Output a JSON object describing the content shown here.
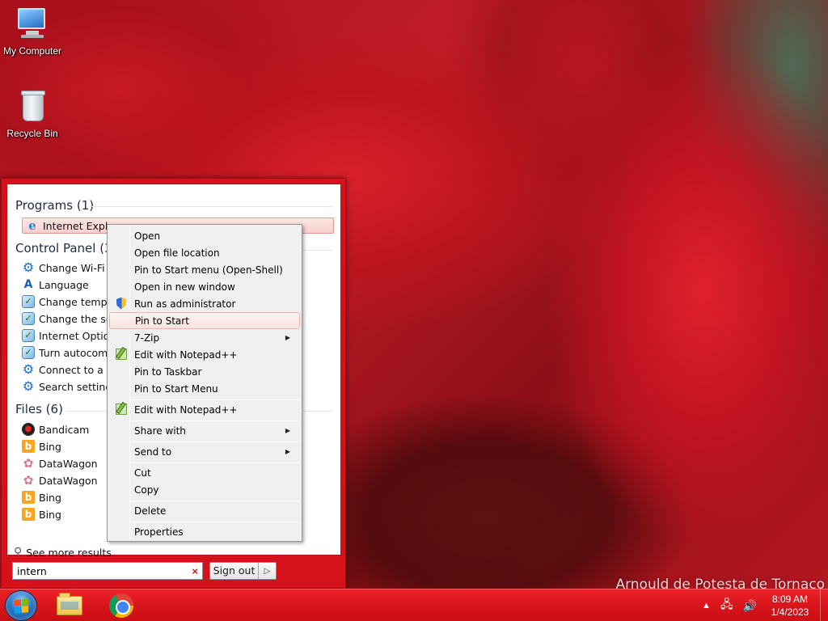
{
  "desktop": {
    "icons": [
      {
        "label": "My Computer",
        "icon": "computer-icon"
      },
      {
        "label": "Recycle Bin",
        "icon": "recycle-bin-icon"
      }
    ],
    "watermark": "Arnould de Potesta de Tornaco"
  },
  "start_menu": {
    "programs_heading": "Programs (1)",
    "programs": [
      {
        "label": "Internet Explorer",
        "icon": "internet-explorer-icon",
        "selected": true
      }
    ],
    "control_panel_heading": "Control Panel (30)",
    "control_panel": [
      {
        "label": "Change Wi-Fi settings",
        "icon": "gear-icon"
      },
      {
        "label": "Language",
        "icon": "language-icon"
      },
      {
        "label": "Change temporary Internet files settings",
        "icon": "control-panel-icon"
      },
      {
        "label": "Change the search provider in Internet Explorer",
        "icon": "control-panel-icon"
      },
      {
        "label": "Internet Options",
        "icon": "control-panel-icon"
      },
      {
        "label": "Turn autocomplete in Internet Explorer on or off",
        "icon": "control-panel-icon"
      },
      {
        "label": "Connect to a network",
        "icon": "gear-icon"
      },
      {
        "label": "Search settings",
        "icon": "gear-icon"
      }
    ],
    "files_heading": "Files (6)",
    "files": [
      {
        "label": "Bandicam",
        "icon": "bandicam-icon"
      },
      {
        "label": "Bing",
        "icon": "bing-icon"
      },
      {
        "label": "DataWagon",
        "icon": "datawagon-icon"
      },
      {
        "label": "DataWagon",
        "icon": "datawagon-icon"
      },
      {
        "label": "Bing",
        "icon": "bing-icon"
      },
      {
        "label": "Bing",
        "icon": "bing-icon"
      }
    ],
    "see_more": "See more results",
    "search": {
      "value": "intern",
      "clear_symbol": "×"
    },
    "sign_out": "Sign out",
    "sign_out_arrow": "▷"
  },
  "context_menu": {
    "items": [
      {
        "label": "Open"
      },
      {
        "label": "Open file location"
      },
      {
        "label": "Pin to Start menu (Open-Shell)"
      },
      {
        "label": "Open in new window"
      },
      {
        "label": "Run as administrator",
        "icon": "uac-shield-icon"
      },
      {
        "label": "Pin to Start",
        "highlighted": true
      },
      {
        "label": "7-Zip",
        "submenu": true
      },
      {
        "label": "Edit with Notepad++",
        "icon": "notepad-plus-plus-icon"
      },
      {
        "label": "Pin to Taskbar"
      },
      {
        "label": "Pin to Start Menu"
      },
      {
        "label": "Edit with Notepad++",
        "icon": "notepad-plus-plus-icon"
      },
      {
        "label": "Share with",
        "submenu": true
      },
      {
        "label": "Send to",
        "submenu": true
      },
      {
        "label": "Cut"
      },
      {
        "label": "Copy"
      },
      {
        "label": "Delete"
      },
      {
        "label": "Properties"
      }
    ],
    "submenu_arrow": "▶"
  },
  "taskbar": {
    "pinned": [
      {
        "name": "File Explorer",
        "icon": "file-explorer-icon"
      },
      {
        "name": "Google Chrome",
        "icon": "chrome-icon"
      }
    ],
    "tray": {
      "show_hidden": "▲",
      "network": "network-icon",
      "volume": "volume-icon",
      "time": "8:09 AM",
      "date": "1/4/2023"
    }
  }
}
